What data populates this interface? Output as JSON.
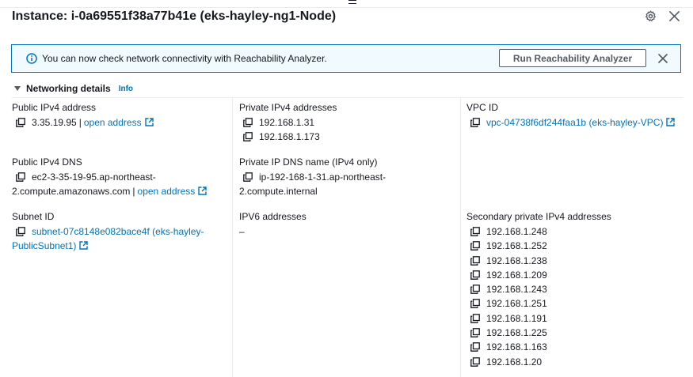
{
  "header": {
    "title": "Instance: i-0a69551f38a77b41e (eks-hayley-ng1-Node)",
    "icons": [
      "settings-icon",
      "close-icon"
    ]
  },
  "alert": {
    "message": "You can now check network connectivity with Reachability Analyzer.",
    "button_label": "Run Reachability Analyzer",
    "icons": [
      "info-icon",
      "dismiss-icon"
    ]
  },
  "section": {
    "title": "Networking details",
    "info_label": "Info"
  },
  "fields": {
    "public_ipv4": {
      "label": "Public IPv4 address",
      "value": "3.35.19.95",
      "separator": "|",
      "link": "open address"
    },
    "private_ipv4": {
      "label": "Private IPv4 addresses",
      "values": [
        "192.168.1.31",
        "192.168.1.173"
      ]
    },
    "vpc_id": {
      "label": "VPC ID",
      "value": "vpc-04738f6df244faa1b (eks-hayley-VPC)"
    },
    "public_dns": {
      "label": "Public IPv4 DNS",
      "line1": "ec2-3-35-19-95.ap-northeast-",
      "line2": "2.compute.amazonaws.com",
      "separator": "|",
      "link": "open address"
    },
    "private_dns": {
      "label": "Private IP DNS name (IPv4 only)",
      "line1": "ip-192-168-1-31.ap-northeast-",
      "line2": "2.compute.internal"
    },
    "subnet_id": {
      "label": "Subnet ID",
      "line1": "subnet-07c8148e082bace4f (eks-hayley-",
      "line2": "PublicSubnet1)"
    },
    "ipv6": {
      "label": "IPV6 addresses",
      "value": "–"
    },
    "secondary_private_ipv4": {
      "label": "Secondary private IPv4 addresses",
      "values": [
        "192.168.1.248",
        "192.168.1.252",
        "192.168.1.238",
        "192.168.1.209",
        "192.168.1.243",
        "192.168.1.251",
        "192.168.1.191",
        "192.168.1.225",
        "192.168.1.163",
        "192.168.1.20"
      ]
    }
  },
  "colors": {
    "link": "#0073bb",
    "text": "#16191f",
    "alert_border": "#0073bb",
    "alert_bg": "#f1faff",
    "divider": "#eaeded"
  }
}
